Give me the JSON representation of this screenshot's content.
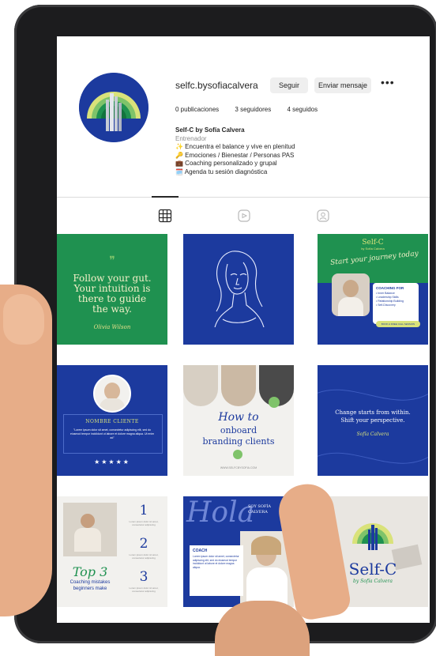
{
  "profile": {
    "username": "selfc.bysofiacalvera",
    "follow_label": "Seguir",
    "message_label": "Enviar mensaje",
    "more_label": "•••",
    "posts": "0 publicaciones",
    "followers": "3 seguidores",
    "following": "4 seguidos",
    "name": "Self-C by Sofía Calvera",
    "category": "Entrenador",
    "bio": [
      "✨ Encuentra el balance y vive en plenitud",
      "🔑 Emociones / Bienestar / Personas PAS",
      "💼 Coaching personalizado y grupal",
      "🗓️ Agenda tu sesión diagnóstica"
    ]
  },
  "tabs": [
    "grid-icon",
    "reels-icon",
    "tagged-icon"
  ],
  "posts": {
    "p1": {
      "lines": [
        "Follow your gut.",
        "Your intuition is",
        "there to guide",
        "the way."
      ],
      "signature": "Olivia Wilson"
    },
    "p3": {
      "brand": "Self-C",
      "brand_sub": "by Sofía Calvera",
      "headline": "Start your journey today",
      "box_title": "COACHING FOR",
      "items": [
        "• Inner Balance",
        "• Leadership Skills",
        "• Relationship Building",
        "• Self-Discovery"
      ],
      "cta": "BOOK A FREE CALL SESSION"
    },
    "p4": {
      "name": "NOMBRE CLIENTE",
      "text": "\"Lorem ipsum dolor sit amet, consectetur adipiscing elit, sed do eiusmod tempor incididunt ut labore et dolore magna aliqua. Ut enim ad\"",
      "stars": "★★★★★"
    },
    "p5": {
      "line1": "How to",
      "line2": "onboard",
      "line3": "branding clients",
      "footer": "WWW.SELFCBYSOFIA.COM"
    },
    "p6": {
      "line1": "Change starts from within.",
      "line2": "Shift your perspective.",
      "signature": "Sofía Calvera"
    },
    "p7": {
      "title": "Top 3",
      "sub1": "Coaching mistakes",
      "sub2": "beginners make",
      "num1": "1",
      "num2": "2",
      "num3": "3",
      "txt1": "Lorem ipsum dolor sit amet, consectetur adipiscing",
      "txt2": "Lorem ipsum dolor sit amet, consectetur adipiscing",
      "txt3": "Lorem ipsum dolor sit amet, consectetur adipiscing"
    },
    "p8": {
      "hola": "Hola",
      "intro1": "SOY SOFÍA",
      "intro2": "CALVERA",
      "box_title": "COACH",
      "box_text": "Lorem ipsum dolor sit amet, consectetur adipiscing elit, sed do eiusmod tempor incididunt ut labore et dolore magna aliqua."
    },
    "p9": {
      "brand": "Self-C",
      "sub": "by Sofía Calvera"
    }
  },
  "colors": {
    "brand_blue": "#1c3a9e",
    "brand_green": "#1f9150",
    "cream": "#f4f0c8"
  }
}
